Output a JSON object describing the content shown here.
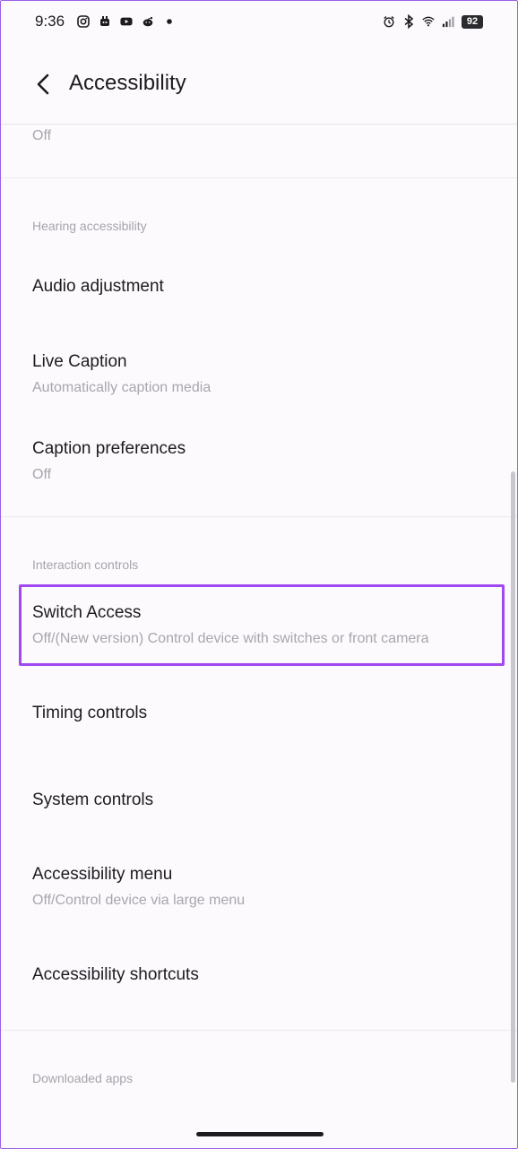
{
  "status_bar": {
    "time": "9:36",
    "battery": "92",
    "left_icons": [
      "instagram-icon",
      "notification-icon",
      "youtube-icon",
      "reddit-icon",
      "dot-icon"
    ],
    "right_icons": [
      "alarm-icon",
      "bluetooth-icon",
      "wifi-icon",
      "signal-icon"
    ]
  },
  "header": {
    "title": "Accessibility",
    "back_icon": "back-arrow-icon"
  },
  "top_item": {
    "subtitle": "Off"
  },
  "sections": {
    "hearing": {
      "header": "Hearing accessibility",
      "items": [
        {
          "title": "Audio adjustment"
        },
        {
          "title": "Live Caption",
          "subtitle": "Automatically caption media"
        },
        {
          "title": "Caption preferences",
          "subtitle": "Off"
        }
      ]
    },
    "interaction": {
      "header": "Interaction controls",
      "items": [
        {
          "title": "Switch Access",
          "subtitle": "Off/(New version) Control device with switches or front camera"
        },
        {
          "title": "Timing controls"
        },
        {
          "title": "System controls"
        },
        {
          "title": "Accessibility menu",
          "subtitle": "Off/Control device via large menu"
        },
        {
          "title": "Accessibility shortcuts"
        }
      ]
    },
    "downloaded": {
      "header": "Downloaded apps"
    }
  },
  "colors": {
    "highlight": "#a148f0",
    "background": "#fcfafd",
    "title_text": "#1c1b1f",
    "subtitle_text": "#a8a6ad"
  }
}
